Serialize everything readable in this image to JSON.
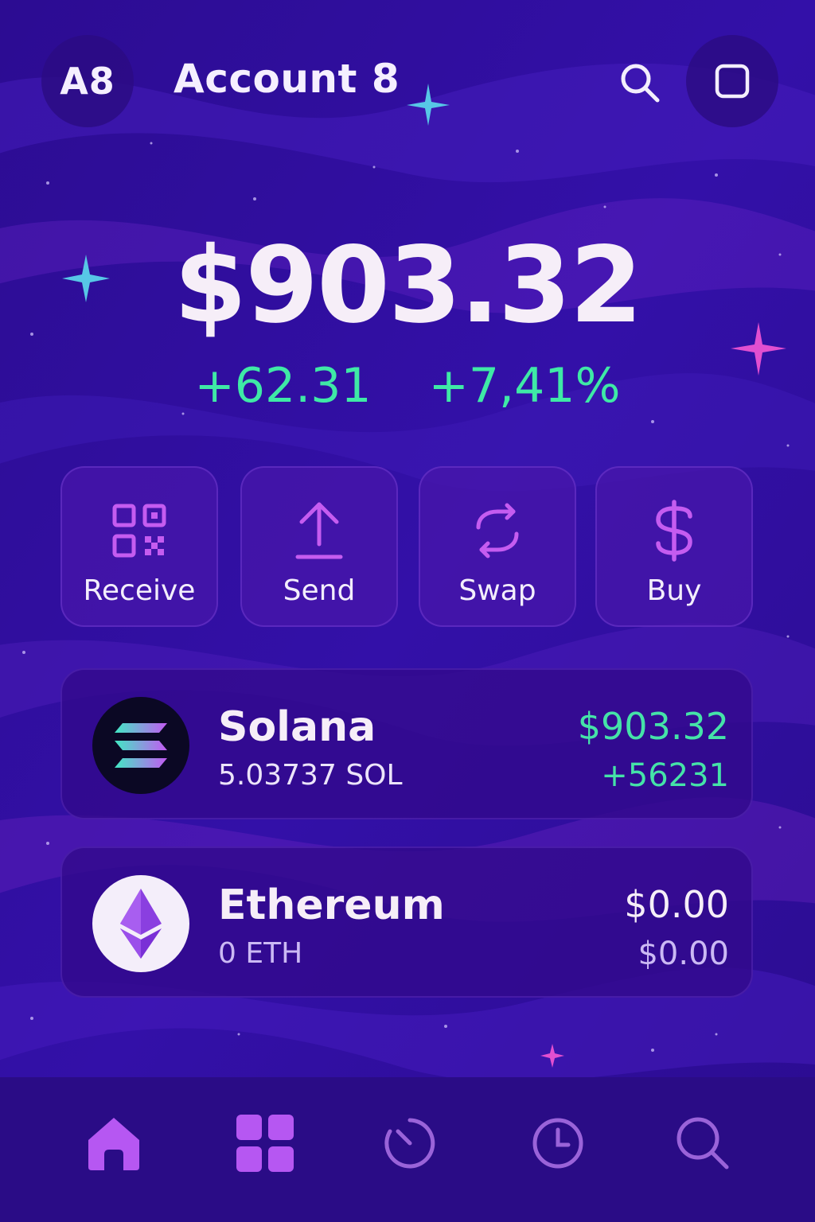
{
  "header": {
    "avatar_initials": "A8",
    "account_name": "Account 8",
    "search_icon": "search-icon",
    "square_icon": "square-icon"
  },
  "balance": {
    "total": "$903.32",
    "change_amount": "+62.31",
    "change_percent": "+7,41%"
  },
  "actions": [
    {
      "label": "Receive",
      "icon": "qr-code-icon"
    },
    {
      "label": "Send",
      "icon": "upload-arrow-icon"
    },
    {
      "label": "Swap",
      "icon": "swap-arrows-icon"
    },
    {
      "label": "Buy",
      "icon": "dollar-icon"
    }
  ],
  "assets": [
    {
      "name": "Solana",
      "amount": "5.03737 SOL",
      "value": "$903.32",
      "change": "+56231",
      "icon": "solana-logo-icon"
    },
    {
      "name": "Ethereum",
      "amount": "0 ETH",
      "value": "$0.00",
      "change": "$0.00",
      "icon": "ethereum-logo-icon"
    }
  ],
  "nav": [
    {
      "icon": "home-icon",
      "active": true
    },
    {
      "icon": "apps-grid-icon",
      "active": false
    },
    {
      "icon": "activity-icon",
      "active": false
    },
    {
      "icon": "clock-icon",
      "active": false
    },
    {
      "icon": "search-icon",
      "active": false
    }
  ],
  "colors": {
    "background": "#2a0d9a",
    "accent": "#b657f2",
    "positive": "#3fe9a6",
    "nav_bar": "#2a0c86"
  }
}
